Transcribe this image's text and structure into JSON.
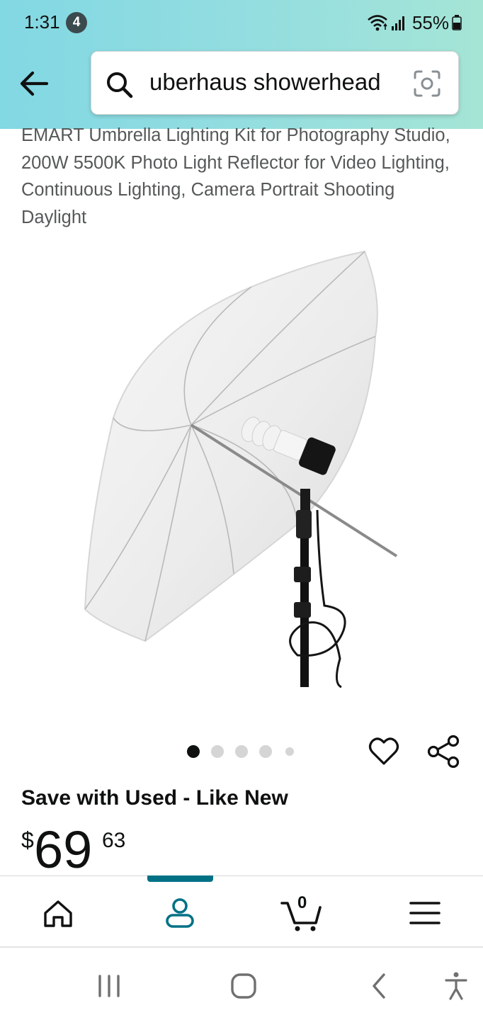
{
  "status_bar": {
    "time": "1:31",
    "notification_count": "4",
    "battery": "55%"
  },
  "search": {
    "query": "uberhaus showerhead"
  },
  "product": {
    "title": "EMART Umbrella Lighting Kit for Photography Studio, 200W 5500K Photo Light Reflector for Video Lighting, Continuous Lighting, Camera Portrait Shooting Daylight",
    "image_count": 5,
    "active_image_index": 0,
    "save_label": "Save with Used - Like New",
    "price_symbol": "$",
    "price_whole": "69",
    "price_fraction": "63"
  },
  "bottom_nav": {
    "items": [
      "home-icon",
      "account-icon",
      "cart-icon",
      "menu-icon"
    ],
    "active": "account",
    "cart_count": "0"
  },
  "colors": {
    "header_gradient_start": "#82d8e3",
    "header_gradient_end": "#a5e5d6",
    "active_nav": "#007185",
    "muted_text": "#565959"
  }
}
